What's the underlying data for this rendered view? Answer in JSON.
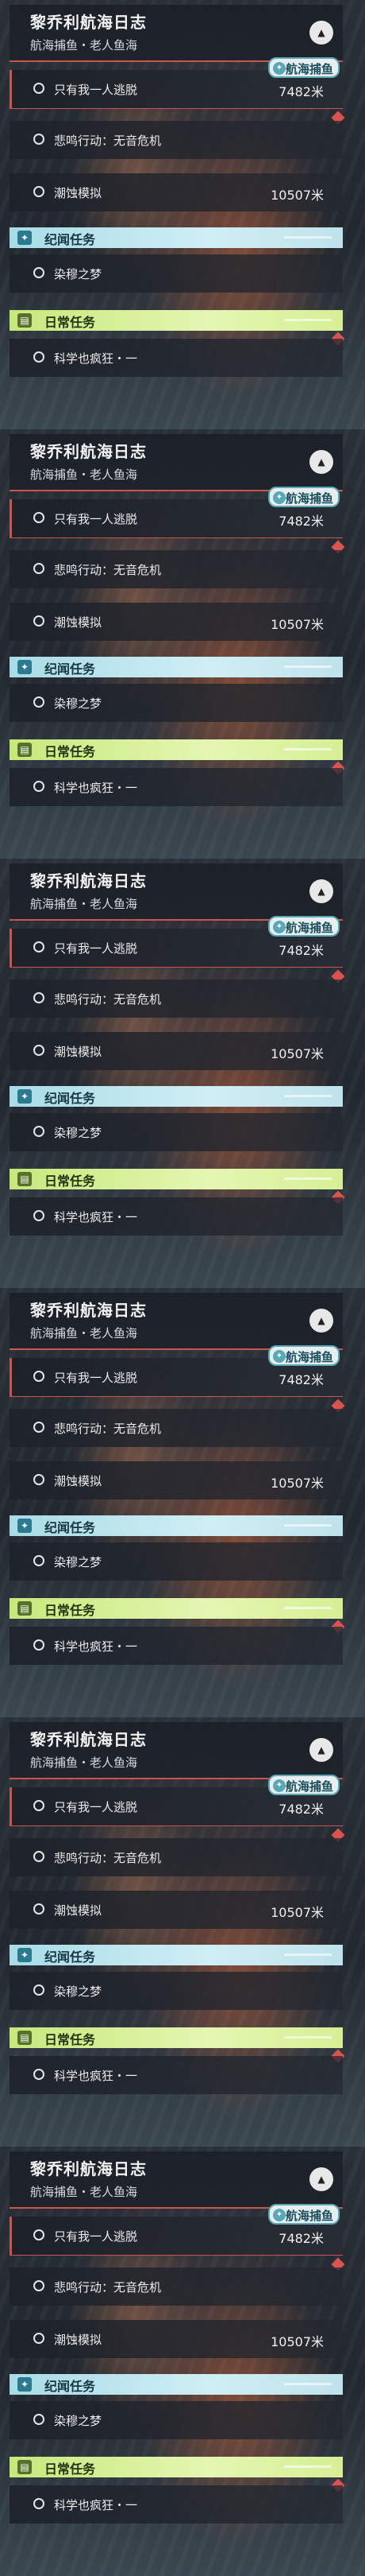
{
  "panel_count": 6,
  "panel": {
    "title": "黎乔利航海日志",
    "subtitle": "航海捕鱼・老人鱼海",
    "tag_label": "航海捕鱼",
    "quest_rows": [
      {
        "label": "只有我一人逃脱",
        "value": "7482米",
        "selected": true
      },
      {
        "label": "悲鸣行动：无音危机",
        "value": ""
      },
      {
        "label": "潮蚀模拟",
        "value": "10507米"
      }
    ],
    "legend_section": {
      "label": "纪闻任务",
      "icon": "star-icon"
    },
    "legend_rows": [
      {
        "label": "染穆之梦"
      }
    ],
    "daily_section": {
      "label": "日常任务",
      "icon": "calendar-icon"
    },
    "daily_rows": [
      {
        "label": "科学也疯狂・一"
      }
    ]
  },
  "colors": {
    "accent_red": "#c9564c",
    "legend_blue": "#a9dbe6",
    "daily_green": "#c7e87b"
  }
}
